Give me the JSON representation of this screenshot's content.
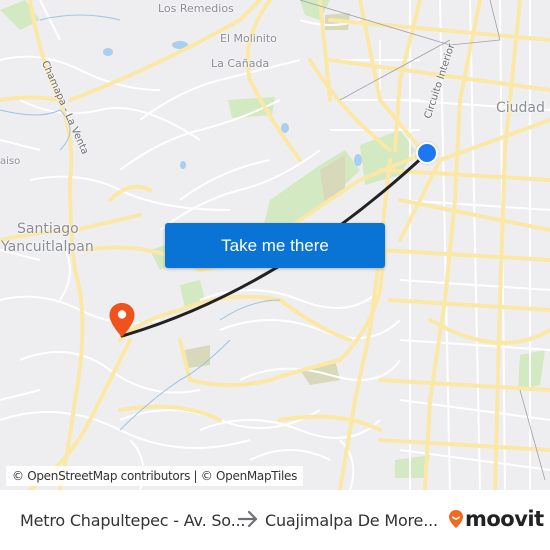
{
  "map": {
    "place_labels": [
      {
        "id": "los-remedios",
        "text": "Los Remedios"
      },
      {
        "id": "el-molinito",
        "text": "El Molinito"
      },
      {
        "id": "la-canada",
        "text": "La Cañada"
      },
      {
        "id": "santiago-line1",
        "text": "Santiago"
      },
      {
        "id": "santiago-line2",
        "text": "Yancuitlalpan"
      },
      {
        "id": "ciudad",
        "text": "Ciudad d"
      },
      {
        "id": "paraiso",
        "text": "aiso"
      }
    ],
    "road_labels": [
      {
        "id": "chamapa-la-venta",
        "text": "Chamapa - La Venta"
      },
      {
        "id": "circuito-interior",
        "text": "Circuito Interior"
      }
    ],
    "attribution": "© OpenStreetMap contributors | © OpenMapTiles",
    "colors": {
      "route_line": "#222222",
      "origin_marker": "#1e77f2",
      "destination_marker": "#f0521c",
      "cta_background": "#0a74d6",
      "major_road": "#fbe8a6",
      "park": "#cde8b6"
    }
  },
  "cta": {
    "label": "Take me there"
  },
  "footer": {
    "origin": "Metro Chapultepec - Av. So...",
    "destination": "Cuajimalpa De More...",
    "brand": "moovit",
    "brand_color": "#f26a21"
  }
}
